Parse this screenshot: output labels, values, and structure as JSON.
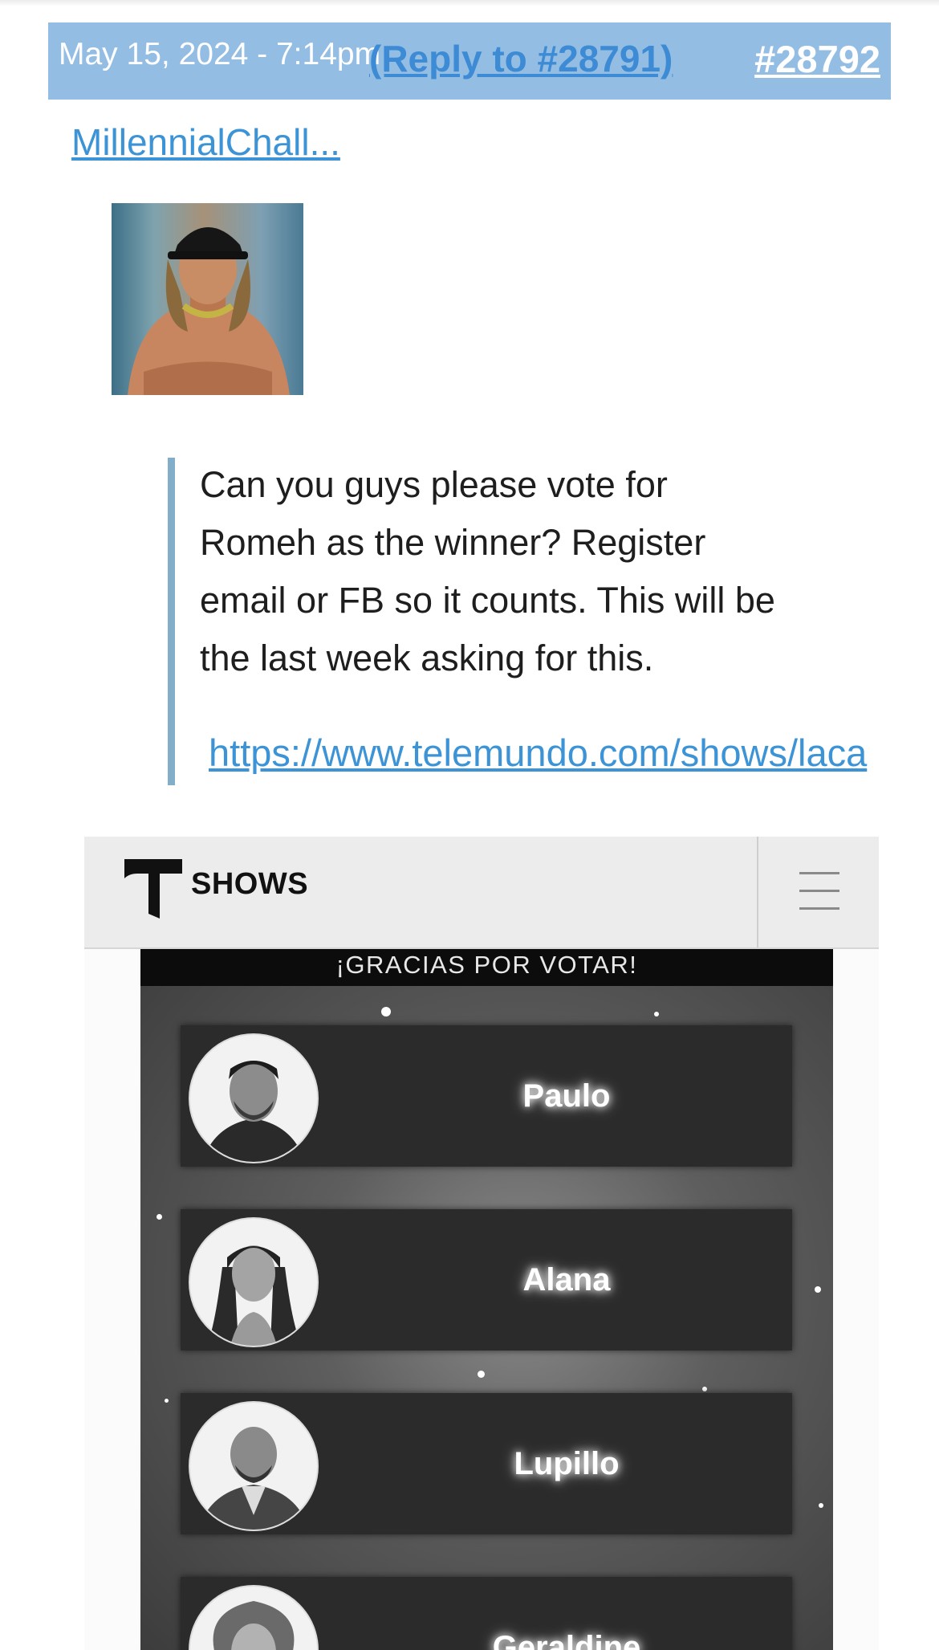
{
  "post": {
    "date": "May 15, 2024 - 7:14pm",
    "reply_to": "(Reply to #28791)",
    "number": "#28792",
    "username": "MillennialChall...",
    "body": "Can you guys please vote for Romeh as the winner? Register email or FB so it counts. This will be the last week asking for this.",
    "link": "https://www.telemundo.com/shows/laca"
  },
  "embed": {
    "nav_title": "SHOWS",
    "banner": "¡GRACIAS POR VOTAR!",
    "candidates": [
      {
        "name": "Paulo"
      },
      {
        "name": "Alana"
      },
      {
        "name": "Lupillo"
      },
      {
        "name": "Geraldine"
      }
    ]
  },
  "colors": {
    "header_bg": "#94bde3",
    "link": "#3c94d6",
    "quote_bar": "#82aec9"
  },
  "icons": [
    "telemundo-t-icon",
    "hamburger-menu-icon"
  ]
}
